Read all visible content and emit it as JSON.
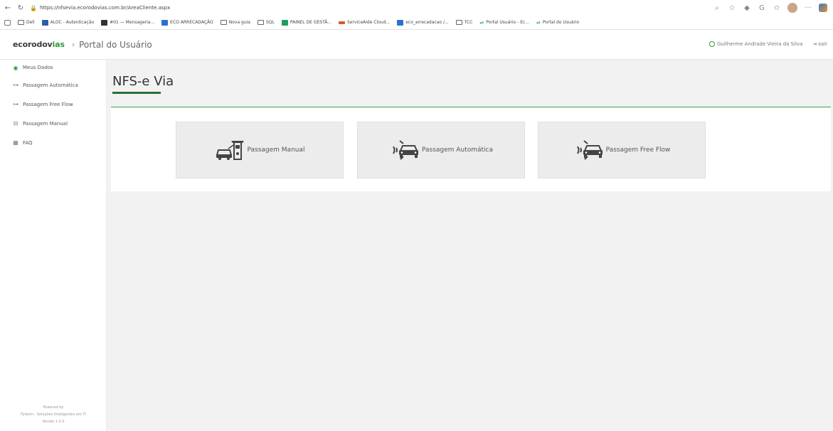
{
  "browser": {
    "url": "https://nfsevia.ecorodovias.com.br/AreaCliente.aspx",
    "bookmarks": [
      "Dell",
      "ALOC - Autenticação",
      "#01 — Mensageria...",
      "ECO ARRECADAÇÃO",
      "Nova guia",
      "SQL",
      "PAINEL DE GESTÃ...",
      "ServiceAide Cloud...",
      "eco_arrecadacao /...",
      "TCC",
      "Portal Usuário - Ec...",
      "Portal do Usuário"
    ]
  },
  "header": {
    "logo_main": "ecorodov",
    "logo_green": "ias",
    "portal_title": "Portal do Usuário",
    "user_name": "Guilherme Andrade Vieira da Silva",
    "logout": "sair"
  },
  "sidebar": {
    "items": [
      {
        "label": "Meus Dados",
        "icon": "user-icon"
      },
      {
        "label": "Passagem Automática",
        "icon": "toll-tag-icon"
      },
      {
        "label": "Passagem Free Flow",
        "icon": "toll-tag-icon"
      },
      {
        "label": "Passagem Manual",
        "icon": "toll-booth-icon"
      },
      {
        "label": "FAQ",
        "icon": "faq-icon"
      }
    ],
    "powered_1": "Powered by",
    "powered_2": "Fyloom - Soluções Inteligentes em TI",
    "version": "Versão 1.0.0"
  },
  "main": {
    "title": "NFS-e Via",
    "tiles": [
      {
        "label": "Passagem Manual",
        "icon": "toll-booth-car-icon"
      },
      {
        "label": "Passagem Automática",
        "icon": "car-signal-icon"
      },
      {
        "label": "Passagem Free Flow",
        "icon": "car-signal-icon"
      }
    ]
  },
  "colors": {
    "accent": "#2e9b3f",
    "title_underline": "#2a6f3a",
    "background": "#f2f2f2"
  }
}
